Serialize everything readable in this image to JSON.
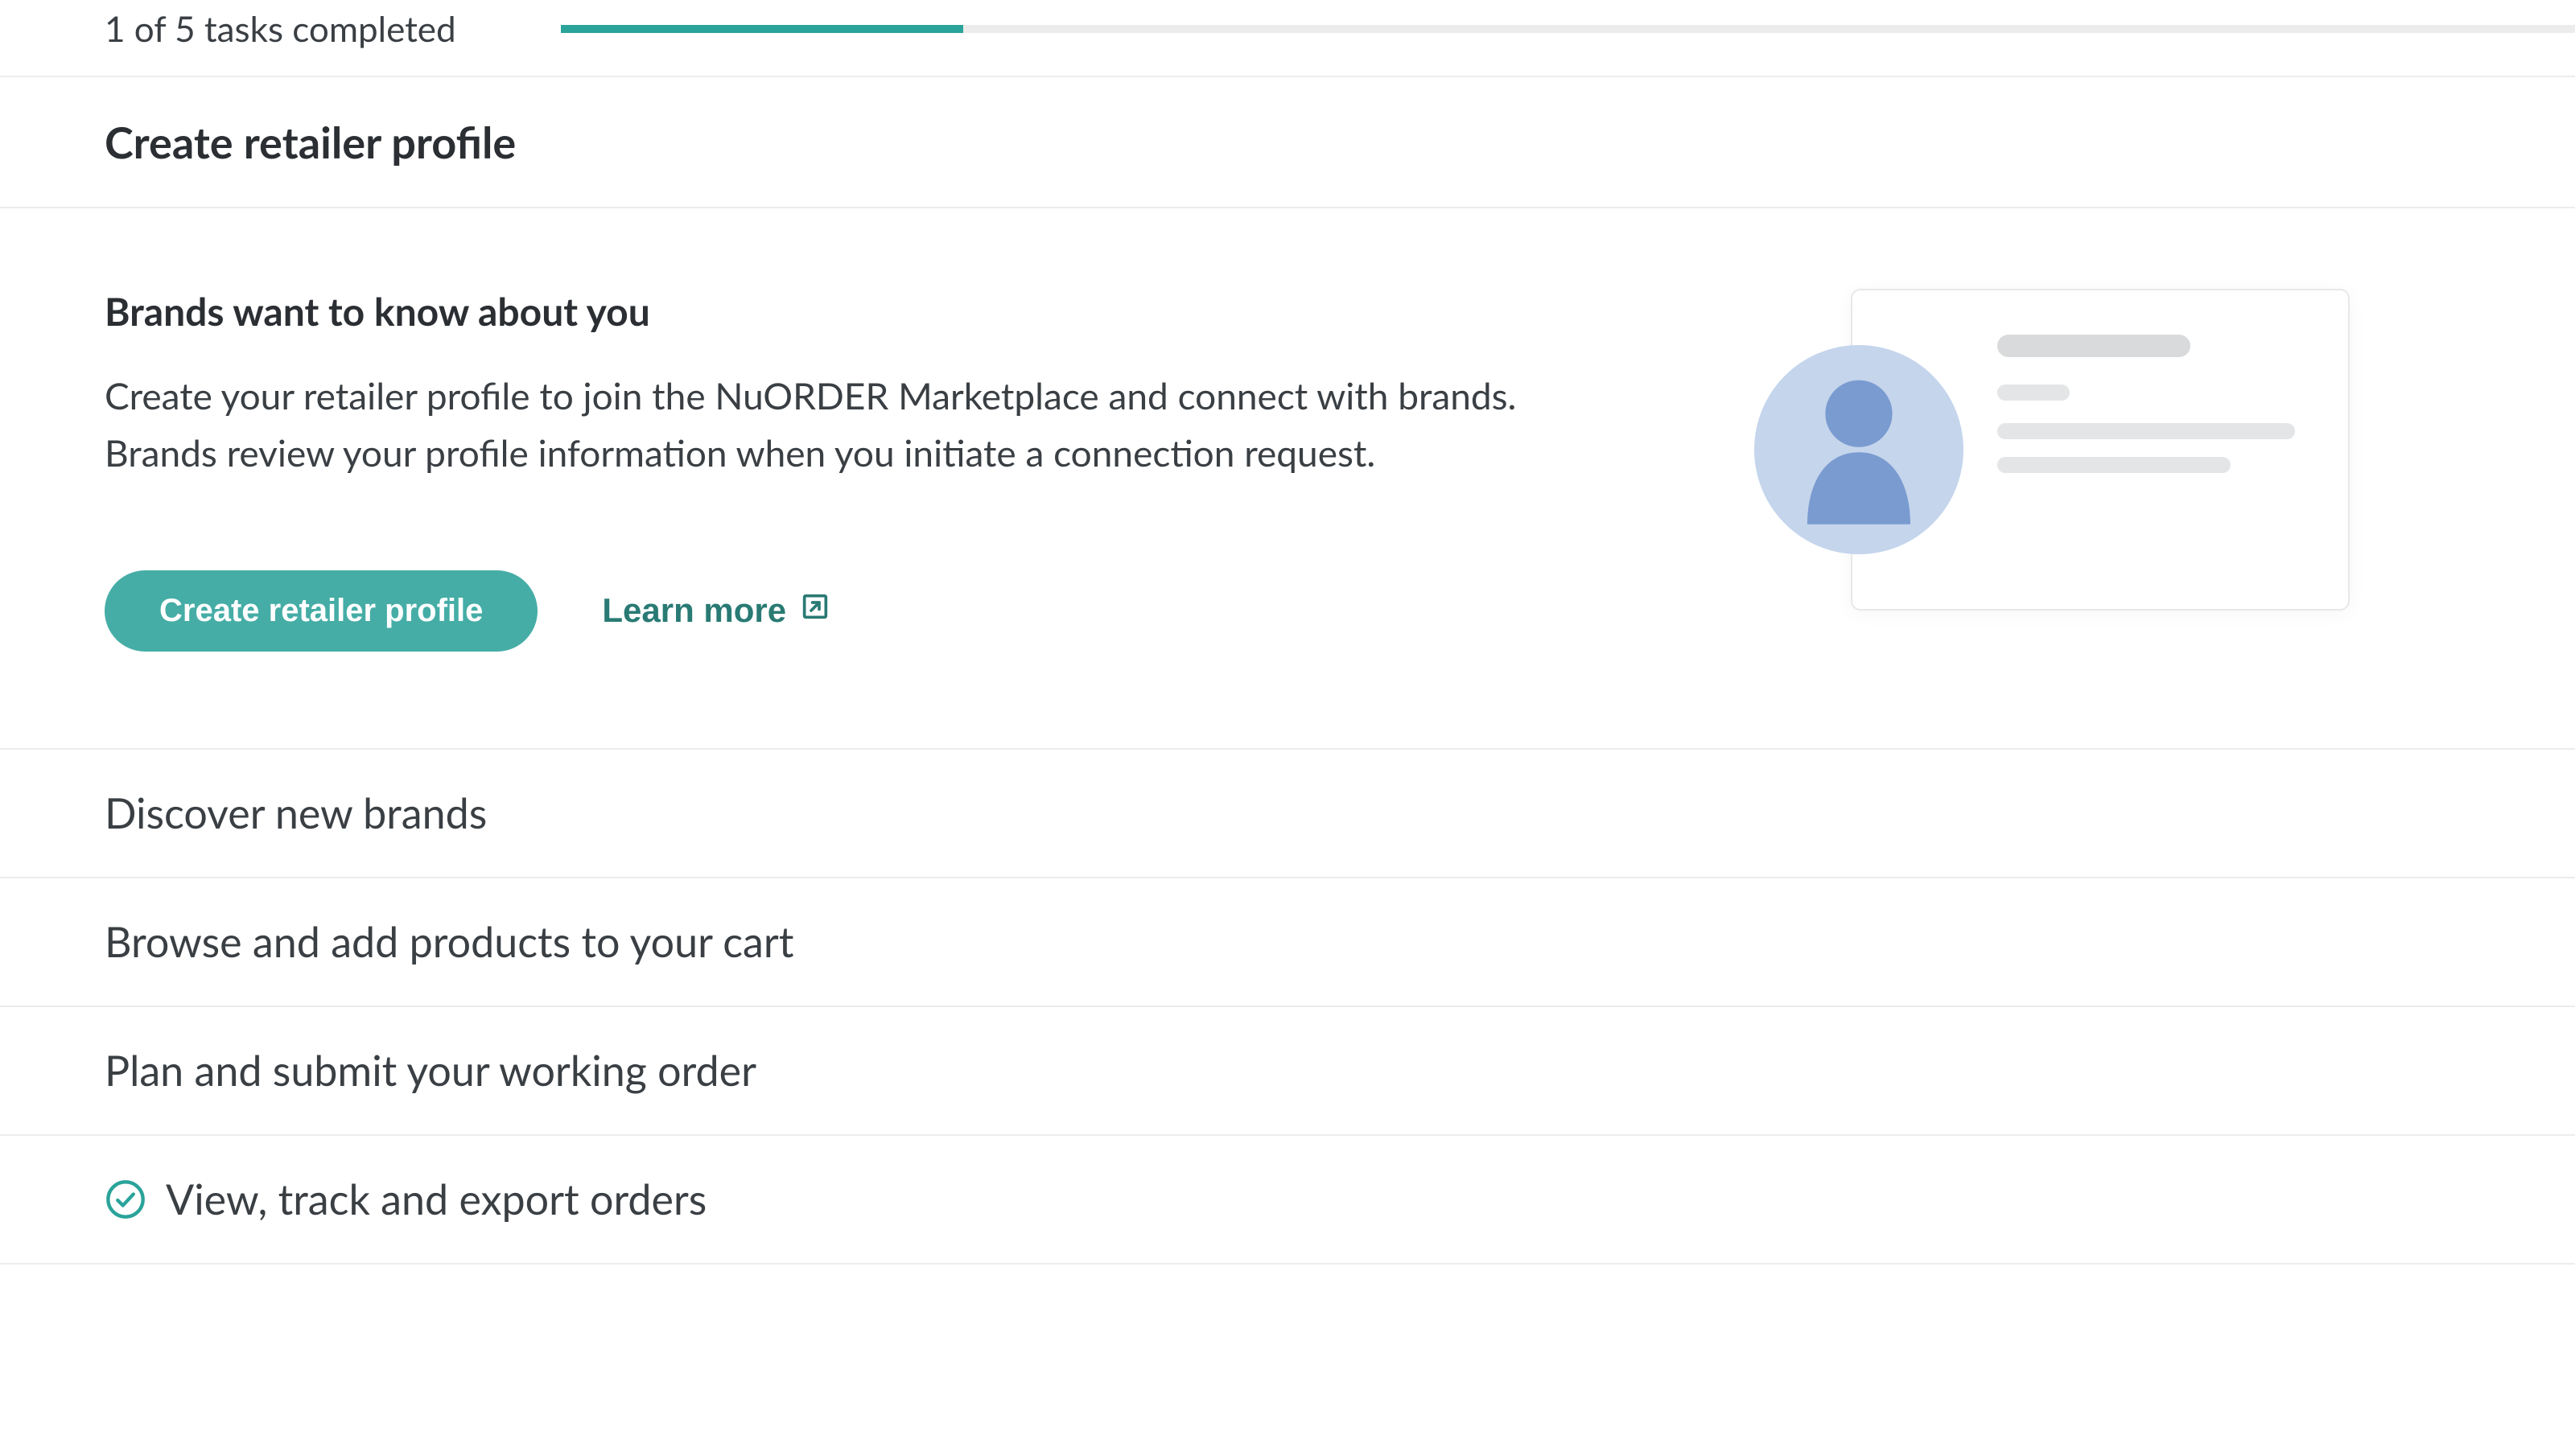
{
  "progress": {
    "label": "1 of 5 tasks completed",
    "completed": 1,
    "total": 5,
    "percent": 20
  },
  "tasks": [
    {
      "title": "Create retailer profile",
      "status": "active",
      "content": {
        "heading": "Brands want to know about you",
        "description": "Create your retailer profile to join the NuORDER Marketplace and connect with brands. Brands review your profile information when you initiate a connection request.",
        "primary_action": "Create retailer profile",
        "secondary_action": "Learn more"
      }
    },
    {
      "title": "Discover new brands",
      "status": "pending"
    },
    {
      "title": "Browse and add products to your cart",
      "status": "pending"
    },
    {
      "title": "Plan and submit your working order",
      "status": "pending"
    },
    {
      "title": "View, track and export orders",
      "status": "completed"
    }
  ],
  "colors": {
    "accent": "#45ada6",
    "accent_dark": "#2a7a74",
    "text": "#2b2f33",
    "muted": "#3a3f44",
    "divider": "#ececec"
  }
}
